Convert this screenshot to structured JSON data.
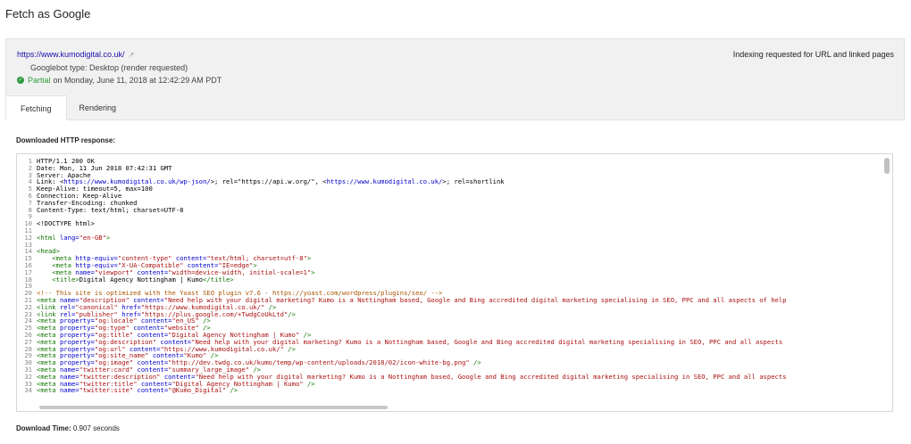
{
  "page": {
    "title": "Fetch as Google"
  },
  "status": {
    "url": "https://www.kumodigital.co.uk/",
    "indexing_text": "Indexing requested for URL and linked pages",
    "bot_type": "Googlebot type: Desktop (render requested)",
    "result_label": "Partial",
    "result_time": "on Monday, June 11, 2018 at 12:42:29 AM PDT"
  },
  "tabs": [
    {
      "label": "Fetching",
      "active": true
    },
    {
      "label": "Rendering",
      "active": false
    }
  ],
  "response": {
    "heading": "Downloaded HTTP response:",
    "lines": [
      [
        {
          "t": "HTTP/1.1 200 OK",
          "c": ""
        }
      ],
      [
        {
          "t": "Date: Mon, 11 Jun 2018 07:42:31 GMT",
          "c": ""
        }
      ],
      [
        {
          "t": "Server: Apache",
          "c": ""
        }
      ],
      [
        {
          "t": "Link: <",
          "c": ""
        },
        {
          "t": "https://www.kumodigital.co.uk/wp-json/",
          "c": "c-link"
        },
        {
          "t": ">; rel=\"https://api.w.org/\", <",
          "c": ""
        },
        {
          "t": "https://www.kumodigital.co.uk/",
          "c": "c-link"
        },
        {
          "t": ">; rel=shortlink",
          "c": ""
        }
      ],
      [
        {
          "t": "Keep-Alive: timeout=5, max=100",
          "c": ""
        }
      ],
      [
        {
          "t": "Connection: Keep-Alive",
          "c": ""
        }
      ],
      [
        {
          "t": "Transfer-Encoding: chunked",
          "c": ""
        }
      ],
      [
        {
          "t": "Content-Type: text/html; charset=UTF-8",
          "c": ""
        }
      ],
      [
        {
          "t": "",
          "c": ""
        }
      ],
      [
        {
          "t": "<!DOCTYPE html>",
          "c": ""
        }
      ],
      [
        {
          "t": "",
          "c": ""
        }
      ],
      [
        {
          "t": "<html ",
          "c": "c-tag"
        },
        {
          "t": "lang=",
          "c": "c-attr"
        },
        {
          "t": "\"en-GB\"",
          "c": "c-str"
        },
        {
          "t": ">",
          "c": "c-tag"
        }
      ],
      [
        {
          "t": "",
          "c": ""
        }
      ],
      [
        {
          "t": "<head>",
          "c": "c-tag"
        }
      ],
      [
        {
          "t": "    <meta ",
          "c": "c-tag"
        },
        {
          "t": "http-equiv=",
          "c": "c-attr"
        },
        {
          "t": "\"content-type\" ",
          "c": "c-str"
        },
        {
          "t": "content=",
          "c": "c-attr"
        },
        {
          "t": "\"text/html; charset=utf-8\"",
          "c": "c-str"
        },
        {
          "t": ">",
          "c": "c-tag"
        }
      ],
      [
        {
          "t": "    <meta ",
          "c": "c-tag"
        },
        {
          "t": "http-equiv=",
          "c": "c-attr"
        },
        {
          "t": "\"X-UA-Compatible\" ",
          "c": "c-str"
        },
        {
          "t": "content=",
          "c": "c-attr"
        },
        {
          "t": "\"IE=edge\"",
          "c": "c-str"
        },
        {
          "t": ">",
          "c": "c-tag"
        }
      ],
      [
        {
          "t": "    <meta ",
          "c": "c-tag"
        },
        {
          "t": "name=",
          "c": "c-attr"
        },
        {
          "t": "\"viewport\" ",
          "c": "c-str"
        },
        {
          "t": "content=",
          "c": "c-attr"
        },
        {
          "t": "\"width=device-width, initial-scale=1\"",
          "c": "c-str"
        },
        {
          "t": ">",
          "c": "c-tag"
        }
      ],
      [
        {
          "t": "    <title>",
          "c": "c-tag"
        },
        {
          "t": "Digital Agency Nottingham | Kumo",
          "c": ""
        },
        {
          "t": "</title>",
          "c": "c-tag"
        }
      ],
      [
        {
          "t": "",
          "c": ""
        }
      ],
      [
        {
          "t": "<!-- This site is optimized with the Yoast SEO plugin v7.6 - https://yoast.com/wordpress/plugins/seo/ -->",
          "c": "c-com"
        }
      ],
      [
        {
          "t": "<meta ",
          "c": "c-tag"
        },
        {
          "t": "name=",
          "c": "c-attr"
        },
        {
          "t": "\"description\" ",
          "c": "c-str"
        },
        {
          "t": "content=",
          "c": "c-attr"
        },
        {
          "t": "\"Need help with your digital marketing? Kumo is a Nottingham based, Google and Bing accredited digital marketing specialising in SEO, PPC and all aspects of help",
          "c": "c-str"
        }
      ],
      [
        {
          "t": "<link ",
          "c": "c-tag"
        },
        {
          "t": "rel=",
          "c": "c-attr"
        },
        {
          "t": "\"canonical\" ",
          "c": "c-str"
        },
        {
          "t": "href=",
          "c": "c-attr"
        },
        {
          "t": "\"https://www.kumodigital.co.uk/\"",
          "c": "c-str"
        },
        {
          "t": " />",
          "c": "c-tag"
        }
      ],
      [
        {
          "t": "<link ",
          "c": "c-tag"
        },
        {
          "t": "rel=",
          "c": "c-attr"
        },
        {
          "t": "\"publisher\" ",
          "c": "c-str"
        },
        {
          "t": "href=",
          "c": "c-attr"
        },
        {
          "t": "\"https://plus.google.com/+TwdgCoUkLtd\"",
          "c": "c-str"
        },
        {
          "t": "/>",
          "c": "c-tag"
        }
      ],
      [
        {
          "t": "<meta ",
          "c": "c-tag"
        },
        {
          "t": "property=",
          "c": "c-attr"
        },
        {
          "t": "\"og:locale\" ",
          "c": "c-str"
        },
        {
          "t": "content=",
          "c": "c-attr"
        },
        {
          "t": "\"en_US\"",
          "c": "c-str"
        },
        {
          "t": " />",
          "c": "c-tag"
        }
      ],
      [
        {
          "t": "<meta ",
          "c": "c-tag"
        },
        {
          "t": "property=",
          "c": "c-attr"
        },
        {
          "t": "\"og:type\" ",
          "c": "c-str"
        },
        {
          "t": "content=",
          "c": "c-attr"
        },
        {
          "t": "\"website\"",
          "c": "c-str"
        },
        {
          "t": " />",
          "c": "c-tag"
        }
      ],
      [
        {
          "t": "<meta ",
          "c": "c-tag"
        },
        {
          "t": "property=",
          "c": "c-attr"
        },
        {
          "t": "\"og:title\" ",
          "c": "c-str"
        },
        {
          "t": "content=",
          "c": "c-attr"
        },
        {
          "t": "\"Digital Agency Nottingham | Kumo\"",
          "c": "c-str"
        },
        {
          "t": " />",
          "c": "c-tag"
        }
      ],
      [
        {
          "t": "<meta ",
          "c": "c-tag"
        },
        {
          "t": "property=",
          "c": "c-attr"
        },
        {
          "t": "\"og:description\" ",
          "c": "c-str"
        },
        {
          "t": "content=",
          "c": "c-attr"
        },
        {
          "t": "\"Need help with your digital marketing? Kumo is a Nottingham based, Google and Bing accredited digital marketing specialising in SEO, PPC and all aspects",
          "c": "c-str"
        }
      ],
      [
        {
          "t": "<meta ",
          "c": "c-tag"
        },
        {
          "t": "property=",
          "c": "c-attr"
        },
        {
          "t": "\"og:url\" ",
          "c": "c-str"
        },
        {
          "t": "content=",
          "c": "c-attr"
        },
        {
          "t": "\"https://www.kumodigital.co.uk/\"",
          "c": "c-str"
        },
        {
          "t": " />",
          "c": "c-tag"
        }
      ],
      [
        {
          "t": "<meta ",
          "c": "c-tag"
        },
        {
          "t": "property=",
          "c": "c-attr"
        },
        {
          "t": "\"og:site_name\" ",
          "c": "c-str"
        },
        {
          "t": "content=",
          "c": "c-attr"
        },
        {
          "t": "\"Kumo\"",
          "c": "c-str"
        },
        {
          "t": " />",
          "c": "c-tag"
        }
      ],
      [
        {
          "t": "<meta ",
          "c": "c-tag"
        },
        {
          "t": "property=",
          "c": "c-attr"
        },
        {
          "t": "\"og:image\" ",
          "c": "c-str"
        },
        {
          "t": "content=",
          "c": "c-attr"
        },
        {
          "t": "\"http://dev.twdg.co.uk/kumo/temp/wp-content/uploads/2018/02/icon-white-bg.png\"",
          "c": "c-str"
        },
        {
          "t": " />",
          "c": "c-tag"
        }
      ],
      [
        {
          "t": "<meta ",
          "c": "c-tag"
        },
        {
          "t": "name=",
          "c": "c-attr"
        },
        {
          "t": "\"twitter:card\" ",
          "c": "c-str"
        },
        {
          "t": "content=",
          "c": "c-attr"
        },
        {
          "t": "\"summary_large_image\"",
          "c": "c-str"
        },
        {
          "t": " />",
          "c": "c-tag"
        }
      ],
      [
        {
          "t": "<meta ",
          "c": "c-tag"
        },
        {
          "t": "name=",
          "c": "c-attr"
        },
        {
          "t": "\"twitter:description\" ",
          "c": "c-str"
        },
        {
          "t": "content=",
          "c": "c-attr"
        },
        {
          "t": "\"Need help with your digital marketing? Kumo is a Nottingham based, Google and Bing accredited digital marketing specialising in SEO, PPC and all aspects",
          "c": "c-str"
        }
      ],
      [
        {
          "t": "<meta ",
          "c": "c-tag"
        },
        {
          "t": "name=",
          "c": "c-attr"
        },
        {
          "t": "\"twitter:title\" ",
          "c": "c-str"
        },
        {
          "t": "content=",
          "c": "c-attr"
        },
        {
          "t": "\"Digital Agency Nottingham | Kumo\"",
          "c": "c-str"
        },
        {
          "t": " />",
          "c": "c-tag"
        }
      ],
      [
        {
          "t": "<meta ",
          "c": "c-tag"
        },
        {
          "t": "name=",
          "c": "c-attr"
        },
        {
          "t": "\"twitter:site\" ",
          "c": "c-str"
        },
        {
          "t": "content=",
          "c": "c-attr"
        },
        {
          "t": "\"@Kumo_Digital\"",
          "c": "c-str"
        },
        {
          "t": " />",
          "c": "c-tag"
        }
      ]
    ]
  },
  "footer": {
    "download_label": "Download Time:",
    "download_value": "0.907 seconds"
  },
  "colors": {
    "accent": "#1a0dab",
    "success": "#2e9a3c"
  },
  "icons": {
    "external": "external-link-icon",
    "status": "check-circle-icon"
  }
}
